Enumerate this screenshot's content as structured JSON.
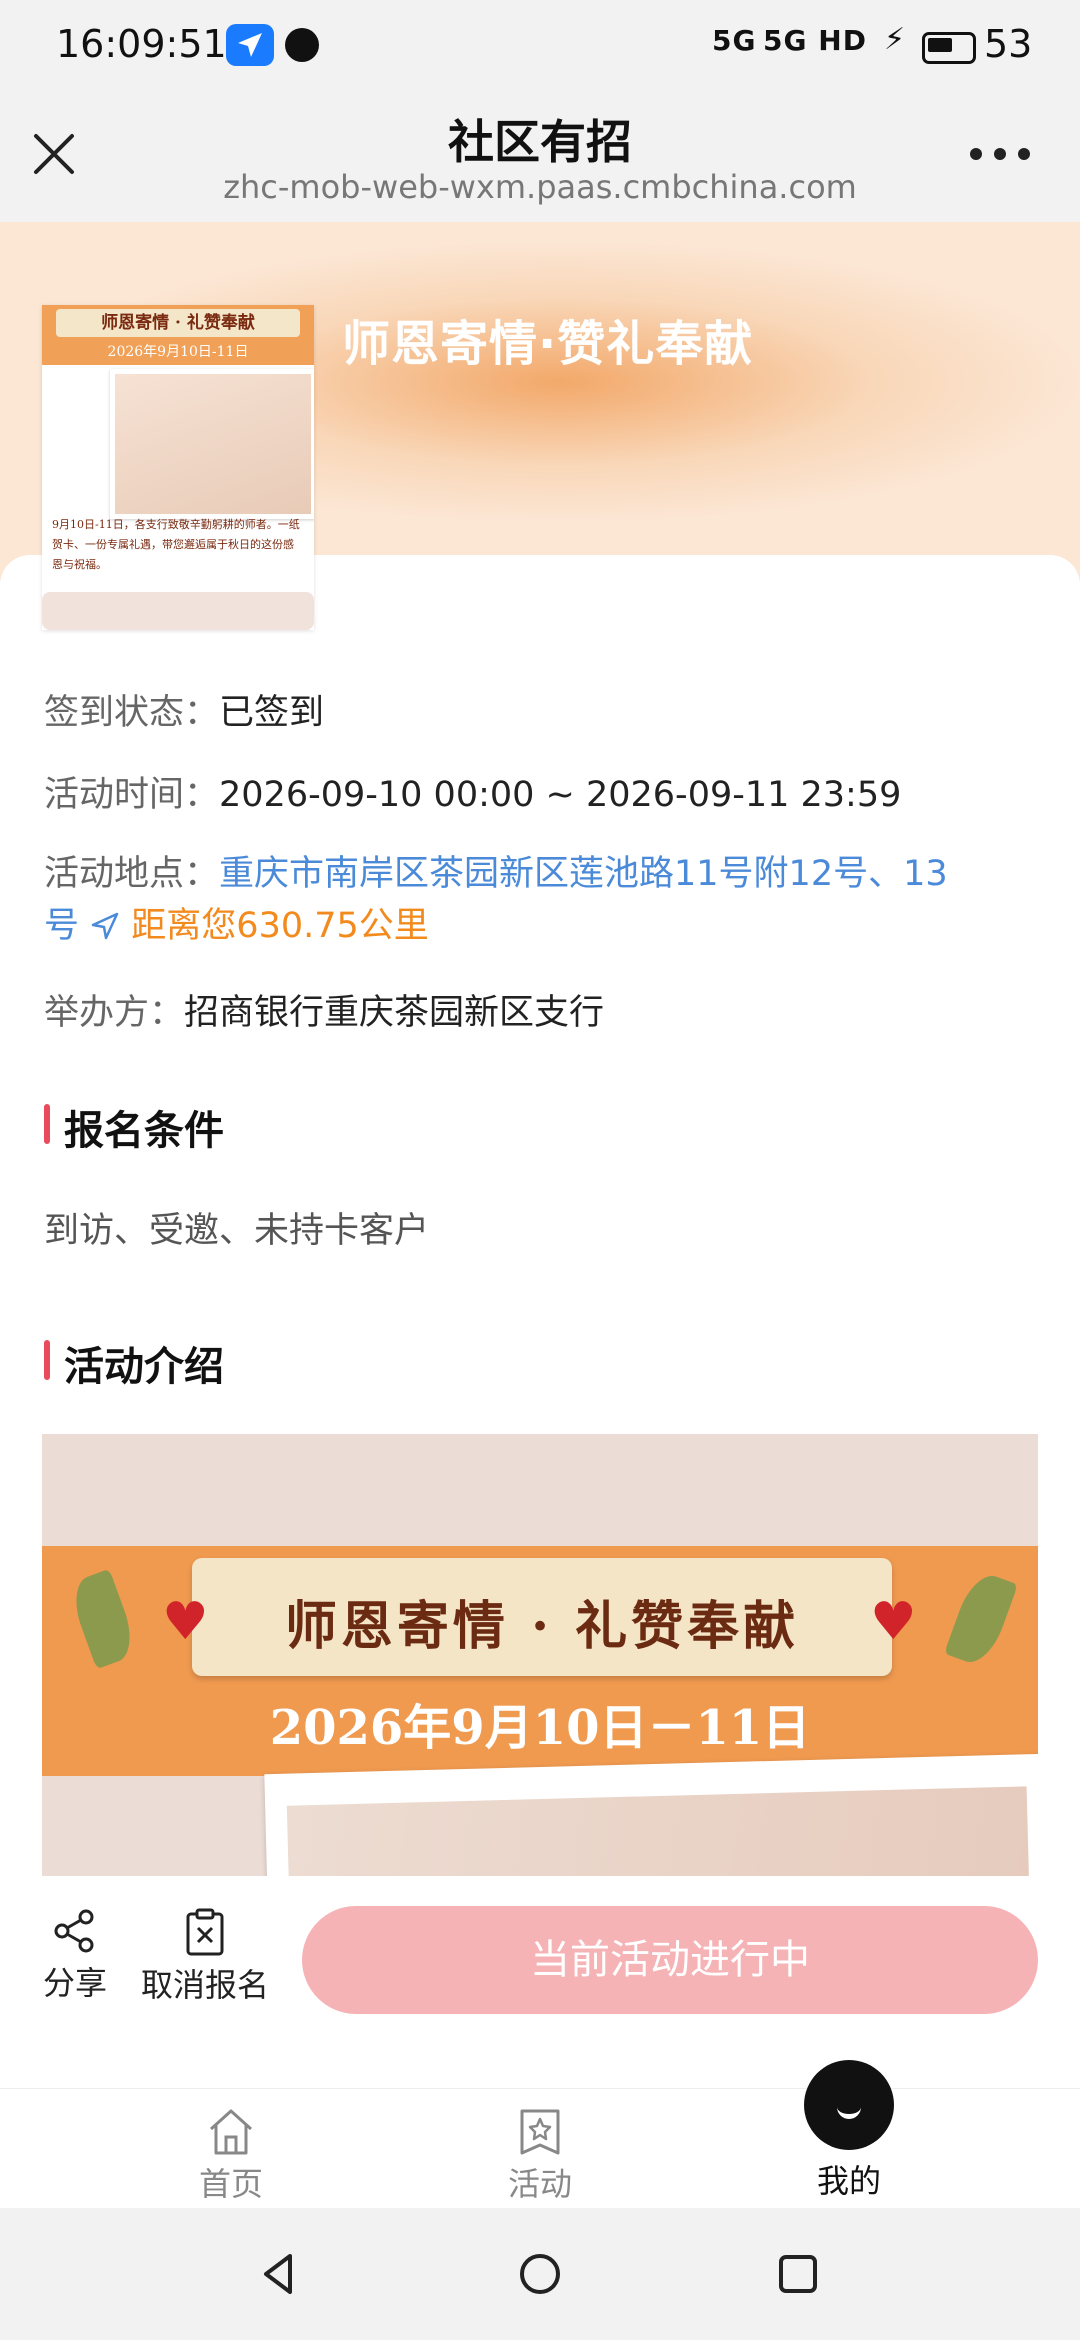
{
  "status_bar": {
    "time": "16:09:51",
    "network": "5G 5G HD",
    "battery": "53"
  },
  "header": {
    "title": "社区有招",
    "url": "zhc-mob-web-wxm.paas.cmbchina.com"
  },
  "hero": {
    "title": "师恩寄情·赞礼奉献"
  },
  "poster": {
    "ribbon": "师恩寄情 · 礼赞奉献",
    "date": "2026年9月10日-11日",
    "text": "9月10日-11日，各支行致敬辛勤躬耕的师者。一纸贺卡、一份专属礼遇，带您邂逅属于秋日的这份感恩与祝福。"
  },
  "info": {
    "signin_label": "签到状态：",
    "signin_value": "已签到",
    "time_label": "活动时间：",
    "time_value": "2026-09-10 00:00 ~ 2026-09-11 23:59",
    "location_label": "活动地点：",
    "location_line1": "重庆市南岸区茶园新区莲池路11号附12号、13",
    "location_line2": "号",
    "distance": "距离您630.75公里",
    "organizer_label": "举办方：",
    "organizer_value": "招商银行重庆茶园新区支行"
  },
  "sections": {
    "requirements_title": "报名条件",
    "requirements_text": "到访、受邀、未持卡客户",
    "intro_title": "活动介绍"
  },
  "banner": {
    "title": "师恩寄情 · 礼赞奉献",
    "date": "2026年9月10日－11日"
  },
  "actions": {
    "share": "分享",
    "cancel": "取消报名",
    "status_button": "当前活动进行中"
  },
  "tabs": {
    "home": "首页",
    "activity": "活动",
    "me": "我的"
  },
  "colors": {
    "accent_pink": "#f6b3b6",
    "link_blue": "#4a8ad8",
    "distance_orange": "#f28a1e",
    "section_marker": "#e84c5c"
  }
}
